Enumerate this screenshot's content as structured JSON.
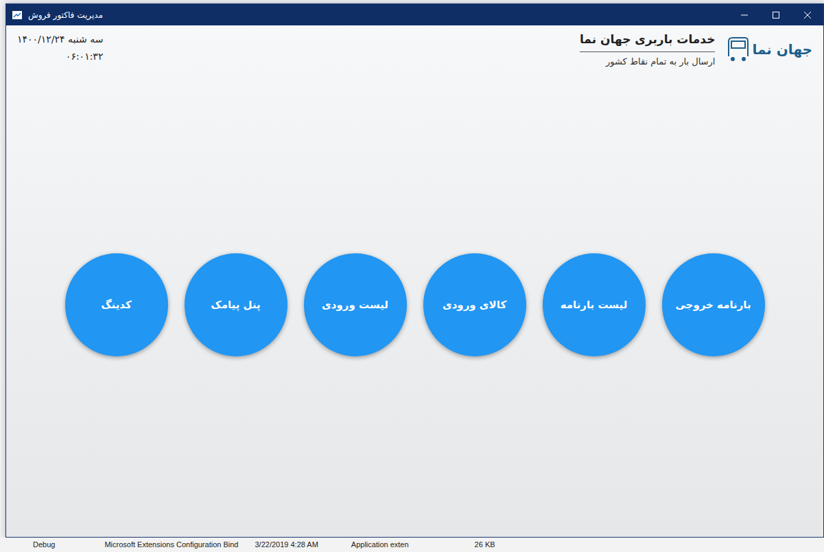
{
  "window": {
    "title": "مدیریت فاکتور فروش"
  },
  "logo": {
    "text": "جهان نما"
  },
  "brand": {
    "title": "خدمات باربری جهان نما",
    "subtitle": "ارسال بار به تمام نقاط کشور"
  },
  "clock": {
    "date": "سه شنبه ۱۴۰۰/۱۲/۲۴",
    "time": "۰۶:۰۱:۳۲"
  },
  "menu": [
    "بارنامه خروجی",
    "لیست بارنامه",
    "کالای ورودی",
    "لیست ورودی",
    "پنل پیامک",
    "کدینگ"
  ],
  "background_row": [
    "Debug",
    "Microsoft Extensions Configuration Bind",
    "3/22/2019 4:28 AM",
    "Application exten",
    "26 KB"
  ]
}
